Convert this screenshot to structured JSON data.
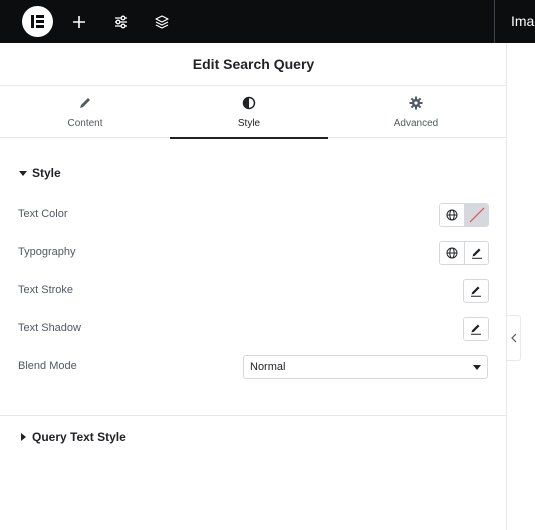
{
  "topbar": {
    "logo": "elementor-logo",
    "add_icon": "plus-icon",
    "settings_icon": "sliders-icon",
    "structure_icon": "layers-icon",
    "right_text": "Imag"
  },
  "panel": {
    "title": "Edit Search Query",
    "tabs": [
      {
        "label": "Content",
        "icon": "pencil-icon",
        "active": false
      },
      {
        "label": "Style",
        "icon": "half-circle-icon",
        "active": true
      },
      {
        "label": "Advanced",
        "icon": "gear-icon",
        "active": false
      }
    ],
    "style_section": {
      "title": "Style",
      "expanded": true,
      "rows": {
        "text_color": "Text Color",
        "typography": "Typography",
        "text_stroke": "Text Stroke",
        "text_shadow": "Text Shadow",
        "blend_mode": "Blend Mode"
      },
      "blend_mode_value": "Normal"
    },
    "query_section": {
      "title": "Query Text Style",
      "expanded": false
    }
  },
  "colors": {
    "topbar_bg": "#0c0d0e",
    "text_primary": "#1f2124",
    "text_secondary": "#515962",
    "border": "#d5d8dc",
    "no_color_slash": "#e34d4d"
  }
}
